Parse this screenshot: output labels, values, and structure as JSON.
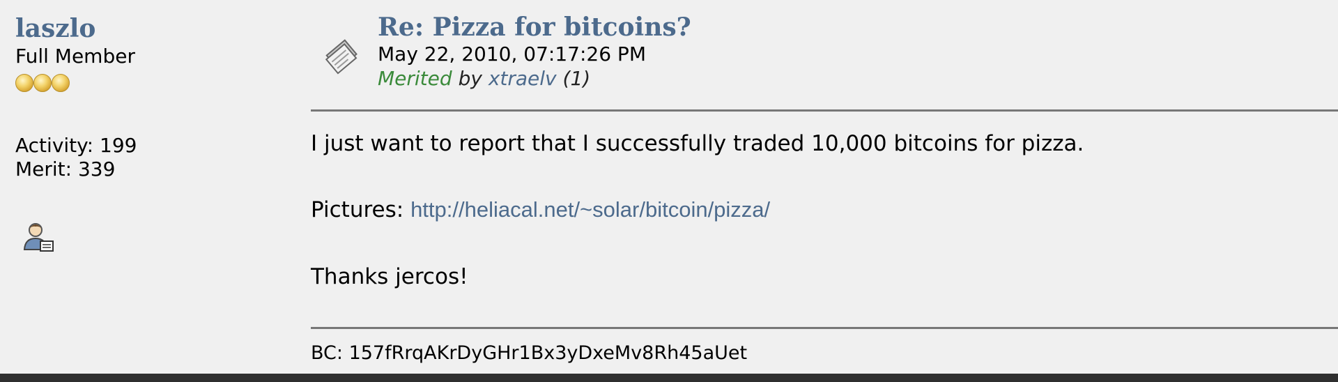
{
  "poster": {
    "username": "laszlo",
    "rank": "Full Member",
    "activity_label": "Activity: 199",
    "merit_label": "Merit: 339",
    "rank_icon": "coin-icon",
    "profile_icon": "user-profile-icon"
  },
  "post": {
    "subject_icon": "post-document-icon",
    "subject": "Re: Pizza for bitcoins?",
    "date": "May 22, 2010, 07:17:26 PM",
    "merit": {
      "word": "Merited",
      "by": "by",
      "user": "xtraelv",
      "count": "(1)"
    },
    "body": {
      "line1": "I just want to report that I successfully traded 10,000 bitcoins for pizza.",
      "pictures_label": "Pictures: ",
      "pictures_link": "http://heliacal.net/~solar/bitcoin/pizza/",
      "line3": "Thanks jercos!"
    },
    "signature": "BC: 157fRrqAKrDyGHr1Bx3yDxeMv8Rh45aUet"
  },
  "colors": {
    "background": "#f0f0f0",
    "link": "#4c6a8c",
    "merit_green": "#3a8a3a",
    "divider": "#777777",
    "coin": "#e2b646"
  }
}
